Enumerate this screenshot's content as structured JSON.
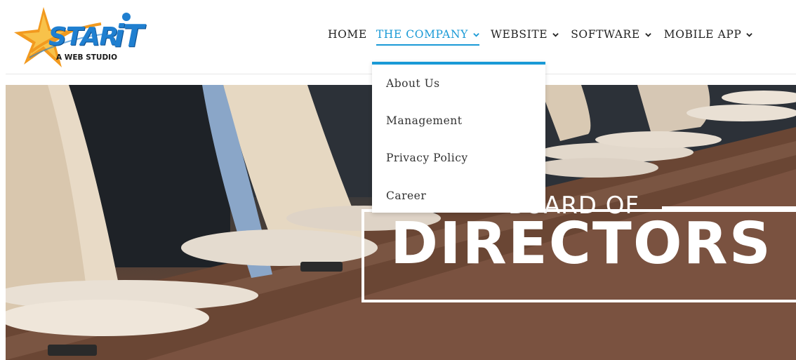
{
  "logo": {
    "brand_star": "STAR",
    "brand_it": "iT",
    "tagline": "A WEB STUDIO"
  },
  "nav": {
    "items": [
      {
        "label": "HOME",
        "has_dropdown": false
      },
      {
        "label": "THE COMPANY",
        "has_dropdown": true,
        "active": true
      },
      {
        "label": "WEBSITE",
        "has_dropdown": true
      },
      {
        "label": "SOFTWARE",
        "has_dropdown": true
      },
      {
        "label": "MOBILE APP",
        "has_dropdown": true
      }
    ]
  },
  "dropdown": {
    "items": [
      {
        "label": "About Us"
      },
      {
        "label": "Management"
      },
      {
        "label": "Privacy Policy"
      },
      {
        "label": "Career"
      }
    ]
  },
  "hero": {
    "line1": "BOARD OF",
    "line2": "DIRECTORS"
  },
  "colors": {
    "accent": "#1a9ad6",
    "brand_blue": "#1f7fd0",
    "brand_orange": "#f29a1f",
    "text": "#222222"
  }
}
